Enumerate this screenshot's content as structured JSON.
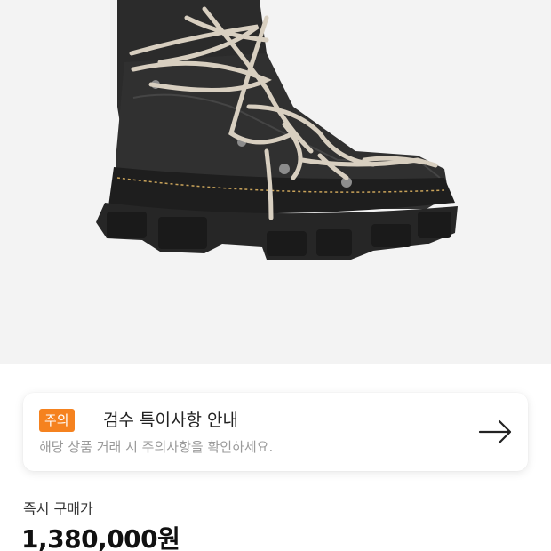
{
  "notice": {
    "badge": "주의",
    "title": "검수 특이사항 안내",
    "subtitle": "해당 상품 거래 시 주의사항을 확인하세요."
  },
  "price": {
    "label": "즉시 구매가",
    "value": "1,380,000원"
  },
  "icons": {
    "arrow": "arrow-right-icon"
  }
}
